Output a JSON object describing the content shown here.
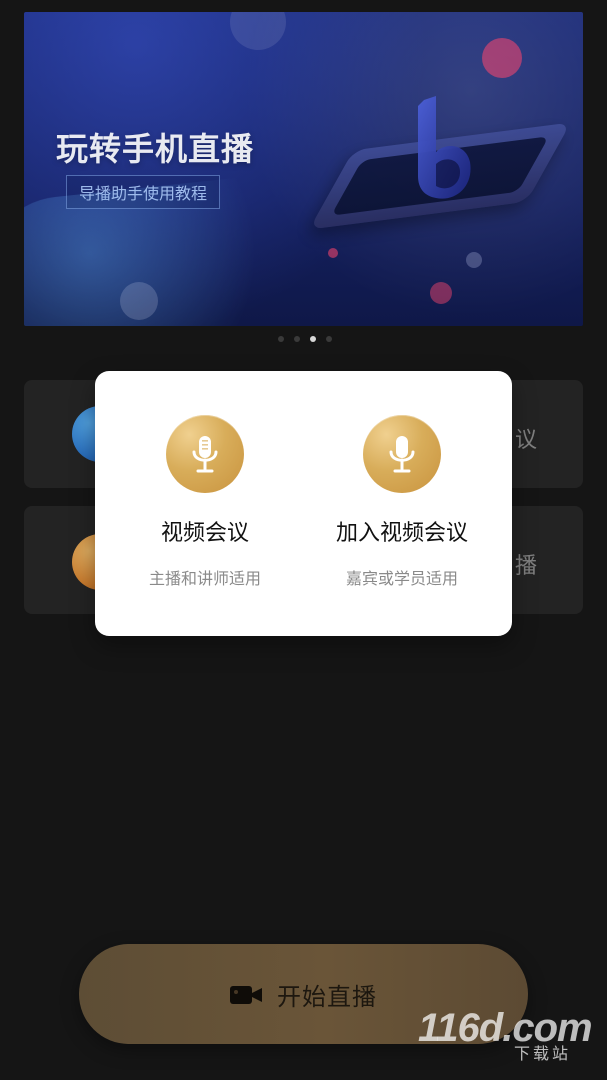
{
  "banner": {
    "title": "玩转手机直播",
    "subtitle": "导播助手使用教程",
    "pager": {
      "count": 4,
      "active_index": 2
    }
  },
  "background_cards": [
    {
      "label": "议"
    },
    {
      "label": "播"
    }
  ],
  "modal": {
    "options": [
      {
        "icon": "microphone-icon",
        "title": "视频会议",
        "subtitle": "主播和讲师适用"
      },
      {
        "icon": "microphone-icon",
        "title": "加入视频会议",
        "subtitle": "嘉宾或学员适用"
      }
    ]
  },
  "start_button": {
    "icon": "video-camera-icon",
    "label": "开始直播"
  },
  "watermark": {
    "top": "116d.com",
    "bottom": "下载站"
  },
  "colors": {
    "background": "#151515",
    "modal_bg": "#ffffff",
    "accent_gold": "#d8ad5a",
    "start_button_bg": "#6a5538"
  }
}
